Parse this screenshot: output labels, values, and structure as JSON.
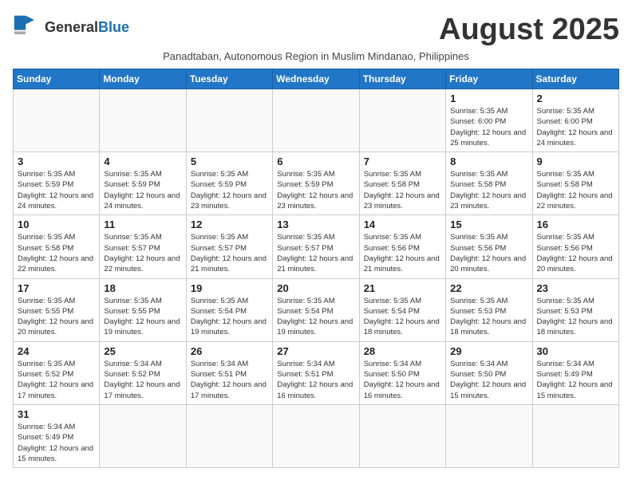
{
  "header": {
    "logo_general": "General",
    "logo_blue": "Blue",
    "month_title": "August 2025",
    "subtitle": "Panadtaban, Autonomous Region in Muslim Mindanao, Philippines"
  },
  "weekdays": [
    "Sunday",
    "Monday",
    "Tuesday",
    "Wednesday",
    "Thursday",
    "Friday",
    "Saturday"
  ],
  "weeks": [
    [
      {
        "day": "",
        "info": ""
      },
      {
        "day": "",
        "info": ""
      },
      {
        "day": "",
        "info": ""
      },
      {
        "day": "",
        "info": ""
      },
      {
        "day": "",
        "info": ""
      },
      {
        "day": "1",
        "info": "Sunrise: 5:35 AM\nSunset: 6:00 PM\nDaylight: 12 hours and 25 minutes."
      },
      {
        "day": "2",
        "info": "Sunrise: 5:35 AM\nSunset: 6:00 PM\nDaylight: 12 hours and 24 minutes."
      }
    ],
    [
      {
        "day": "3",
        "info": "Sunrise: 5:35 AM\nSunset: 5:59 PM\nDaylight: 12 hours and 24 minutes."
      },
      {
        "day": "4",
        "info": "Sunrise: 5:35 AM\nSunset: 5:59 PM\nDaylight: 12 hours and 24 minutes."
      },
      {
        "day": "5",
        "info": "Sunrise: 5:35 AM\nSunset: 5:59 PM\nDaylight: 12 hours and 23 minutes."
      },
      {
        "day": "6",
        "info": "Sunrise: 5:35 AM\nSunset: 5:59 PM\nDaylight: 12 hours and 23 minutes."
      },
      {
        "day": "7",
        "info": "Sunrise: 5:35 AM\nSunset: 5:58 PM\nDaylight: 12 hours and 23 minutes."
      },
      {
        "day": "8",
        "info": "Sunrise: 5:35 AM\nSunset: 5:58 PM\nDaylight: 12 hours and 23 minutes."
      },
      {
        "day": "9",
        "info": "Sunrise: 5:35 AM\nSunset: 5:58 PM\nDaylight: 12 hours and 22 minutes."
      }
    ],
    [
      {
        "day": "10",
        "info": "Sunrise: 5:35 AM\nSunset: 5:58 PM\nDaylight: 12 hours and 22 minutes."
      },
      {
        "day": "11",
        "info": "Sunrise: 5:35 AM\nSunset: 5:57 PM\nDaylight: 12 hours and 22 minutes."
      },
      {
        "day": "12",
        "info": "Sunrise: 5:35 AM\nSunset: 5:57 PM\nDaylight: 12 hours and 21 minutes."
      },
      {
        "day": "13",
        "info": "Sunrise: 5:35 AM\nSunset: 5:57 PM\nDaylight: 12 hours and 21 minutes."
      },
      {
        "day": "14",
        "info": "Sunrise: 5:35 AM\nSunset: 5:56 PM\nDaylight: 12 hours and 21 minutes."
      },
      {
        "day": "15",
        "info": "Sunrise: 5:35 AM\nSunset: 5:56 PM\nDaylight: 12 hours and 20 minutes."
      },
      {
        "day": "16",
        "info": "Sunrise: 5:35 AM\nSunset: 5:56 PM\nDaylight: 12 hours and 20 minutes."
      }
    ],
    [
      {
        "day": "17",
        "info": "Sunrise: 5:35 AM\nSunset: 5:55 PM\nDaylight: 12 hours and 20 minutes."
      },
      {
        "day": "18",
        "info": "Sunrise: 5:35 AM\nSunset: 5:55 PM\nDaylight: 12 hours and 19 minutes."
      },
      {
        "day": "19",
        "info": "Sunrise: 5:35 AM\nSunset: 5:54 PM\nDaylight: 12 hours and 19 minutes."
      },
      {
        "day": "20",
        "info": "Sunrise: 5:35 AM\nSunset: 5:54 PM\nDaylight: 12 hours and 19 minutes."
      },
      {
        "day": "21",
        "info": "Sunrise: 5:35 AM\nSunset: 5:54 PM\nDaylight: 12 hours and 18 minutes."
      },
      {
        "day": "22",
        "info": "Sunrise: 5:35 AM\nSunset: 5:53 PM\nDaylight: 12 hours and 18 minutes."
      },
      {
        "day": "23",
        "info": "Sunrise: 5:35 AM\nSunset: 5:53 PM\nDaylight: 12 hours and 18 minutes."
      }
    ],
    [
      {
        "day": "24",
        "info": "Sunrise: 5:35 AM\nSunset: 5:52 PM\nDaylight: 12 hours and 17 minutes."
      },
      {
        "day": "25",
        "info": "Sunrise: 5:34 AM\nSunset: 5:52 PM\nDaylight: 12 hours and 17 minutes."
      },
      {
        "day": "26",
        "info": "Sunrise: 5:34 AM\nSunset: 5:51 PM\nDaylight: 12 hours and 17 minutes."
      },
      {
        "day": "27",
        "info": "Sunrise: 5:34 AM\nSunset: 5:51 PM\nDaylight: 12 hours and 16 minutes."
      },
      {
        "day": "28",
        "info": "Sunrise: 5:34 AM\nSunset: 5:50 PM\nDaylight: 12 hours and 16 minutes."
      },
      {
        "day": "29",
        "info": "Sunrise: 5:34 AM\nSunset: 5:50 PM\nDaylight: 12 hours and 15 minutes."
      },
      {
        "day": "30",
        "info": "Sunrise: 5:34 AM\nSunset: 5:49 PM\nDaylight: 12 hours and 15 minutes."
      }
    ],
    [
      {
        "day": "31",
        "info": "Sunrise: 5:34 AM\nSunset: 5:49 PM\nDaylight: 12 hours and 15 minutes."
      },
      {
        "day": "",
        "info": ""
      },
      {
        "day": "",
        "info": ""
      },
      {
        "day": "",
        "info": ""
      },
      {
        "day": "",
        "info": ""
      },
      {
        "day": "",
        "info": ""
      },
      {
        "day": "",
        "info": ""
      }
    ]
  ]
}
